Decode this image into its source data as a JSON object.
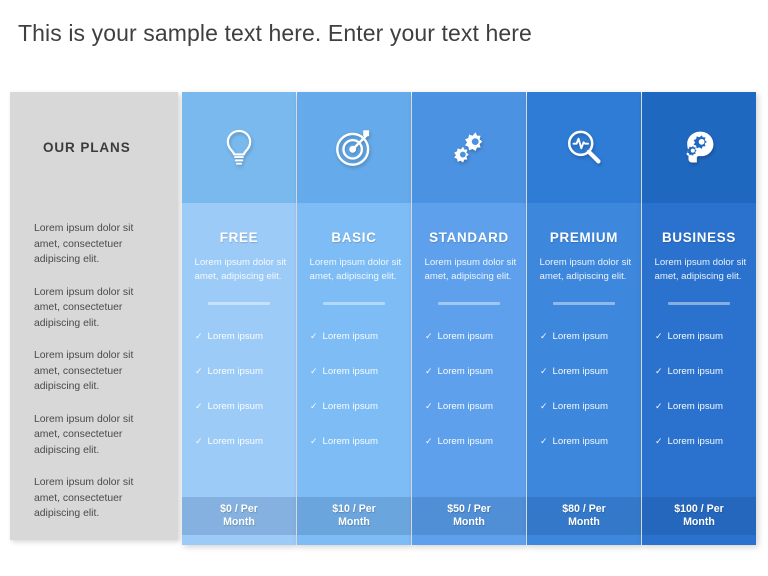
{
  "page": {
    "title": "This is your sample text here. Enter your text here"
  },
  "features_panel": {
    "header_label": "OUR PLANS",
    "rows": [
      "Lorem ipsum dolor sit amet, consectetuer adipiscing elit.",
      "Lorem ipsum dolor sit amet, consectetuer adipiscing elit.",
      "Lorem ipsum dolor sit amet, consectetuer adipiscing elit.",
      "Lorem ipsum dolor sit amet, consectetuer adipiscing elit.",
      "Lorem ipsum dolor sit amet, consectetuer adipiscing elit."
    ]
  },
  "plans": [
    {
      "name": "FREE",
      "icon": "lightbulb-icon",
      "description": "Lorem ipsum dolor sit amet, adipiscing elit.",
      "features": [
        "Lorem ipsum",
        "Lorem ipsum",
        "Lorem ipsum",
        "Lorem ipsum"
      ],
      "check_glyph": "✓",
      "price": "$0 / Per Month",
      "header_color": "#79B9EE",
      "body_color": "#9DCBF7"
    },
    {
      "name": "BASIC",
      "icon": "target-icon",
      "description": "Lorem ipsum dolor sit amet, adipiscing elit.",
      "features": [
        "Lorem ipsum",
        "Lorem ipsum",
        "Lorem ipsum",
        "Lorem ipsum"
      ],
      "check_glyph": "✓",
      "price": "$10 / Per Month",
      "header_color": "#65AAEA",
      "body_color": "#7DBCF4"
    },
    {
      "name": "STANDARD",
      "icon": "gears-icon",
      "description": "Lorem ipsum dolor sit amet, adipiscing elit.",
      "features": [
        "Lorem ipsum",
        "Lorem ipsum",
        "Lorem ipsum",
        "Lorem ipsum"
      ],
      "check_glyph": "✓",
      "price": "$50 / Per Month",
      "header_color": "#4C92E2",
      "body_color": "#5EA0EB"
    },
    {
      "name": "PREMIUM",
      "icon": "magnifier-pulse-icon",
      "description": "Lorem ipsum dolor sit amet, adipiscing elit.",
      "features": [
        "Lorem ipsum",
        "Lorem ipsum",
        "Lorem ipsum",
        "Lorem ipsum"
      ],
      "check_glyph": "✓",
      "price": "$80 / Per Month",
      "header_color": "#2E7CD6",
      "body_color": "#3D87DC"
    },
    {
      "name": "BUSINESS",
      "icon": "head-gears-icon",
      "description": "Lorem ipsum dolor sit amet, adipiscing elit.",
      "features": [
        "Lorem ipsum",
        "Lorem ipsum",
        "Lorem ipsum",
        "Lorem ipsum"
      ],
      "check_glyph": "✓",
      "price": "$100 / Per Month",
      "header_color": "#1F68C0",
      "body_color": "#2B72CE"
    }
  ],
  "theme": {
    "panel_gray": "#d8d8d8",
    "title_color": "#3f3f3f",
    "plan_text_color": "#ffffff"
  }
}
